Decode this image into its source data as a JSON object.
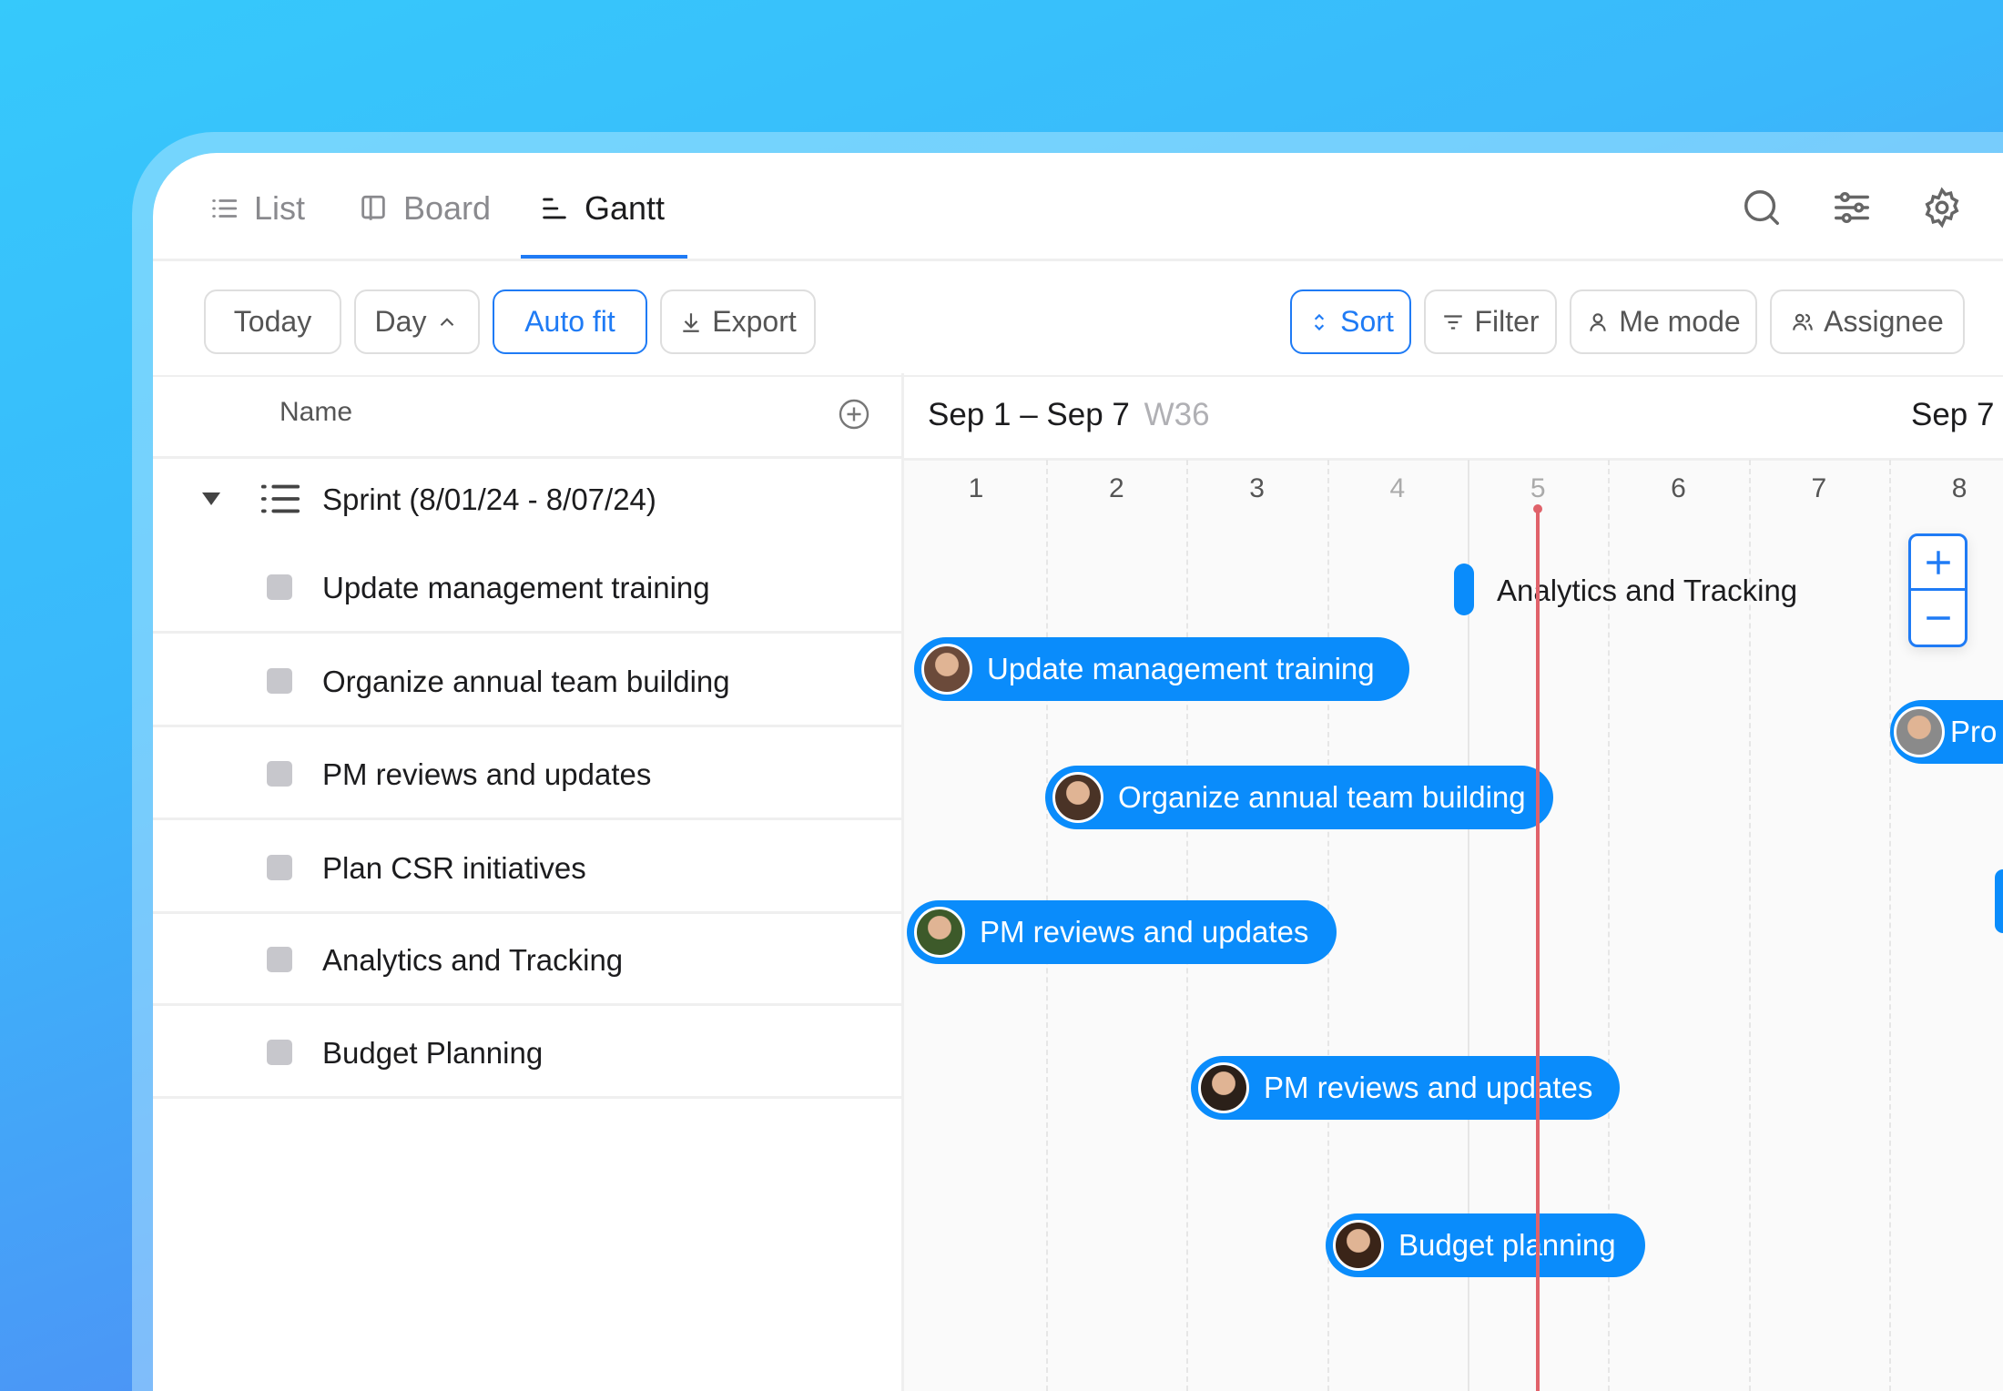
{
  "tabs": [
    {
      "label": "List",
      "icon": "list-icon"
    },
    {
      "label": "Board",
      "icon": "board-icon"
    },
    {
      "label": "Gantt",
      "icon": "gantt-icon",
      "active": true
    }
  ],
  "header_icons": [
    "search-icon",
    "sliders-icon",
    "gear-icon"
  ],
  "toolbar": {
    "today": "Today",
    "day": "Day",
    "auto_fit": "Auto fit",
    "export": "Export",
    "sort": "Sort",
    "filter": "Filter",
    "me_mode": "Me mode",
    "assignee": "Assignee"
  },
  "list": {
    "name_header": "Name",
    "group": "Sprint (8/01/24 - 8/07/24)",
    "tasks": [
      "Update management training",
      "Organize annual team building",
      "PM reviews and updates",
      "Plan CSR initiatives",
      "Analytics and Tracking",
      "Budget Planning"
    ]
  },
  "timeline": {
    "range": "Sep 1 – Sep 7",
    "week": "W36",
    "next_range": "Sep 7",
    "days": [
      "1",
      "2",
      "3",
      "4",
      "5",
      "6",
      "7",
      "8"
    ],
    "today_day": "5",
    "milestone": "Analytics and Tracking",
    "bars": [
      "Update management training",
      "Organize annual team building",
      "PM reviews and updates",
      "PM reviews and updates",
      "Budget planning",
      "Pro"
    ]
  },
  "colors": {
    "accent": "#1f7bf5",
    "bar": "#0a8cfb",
    "today_line": "#e0626a"
  }
}
